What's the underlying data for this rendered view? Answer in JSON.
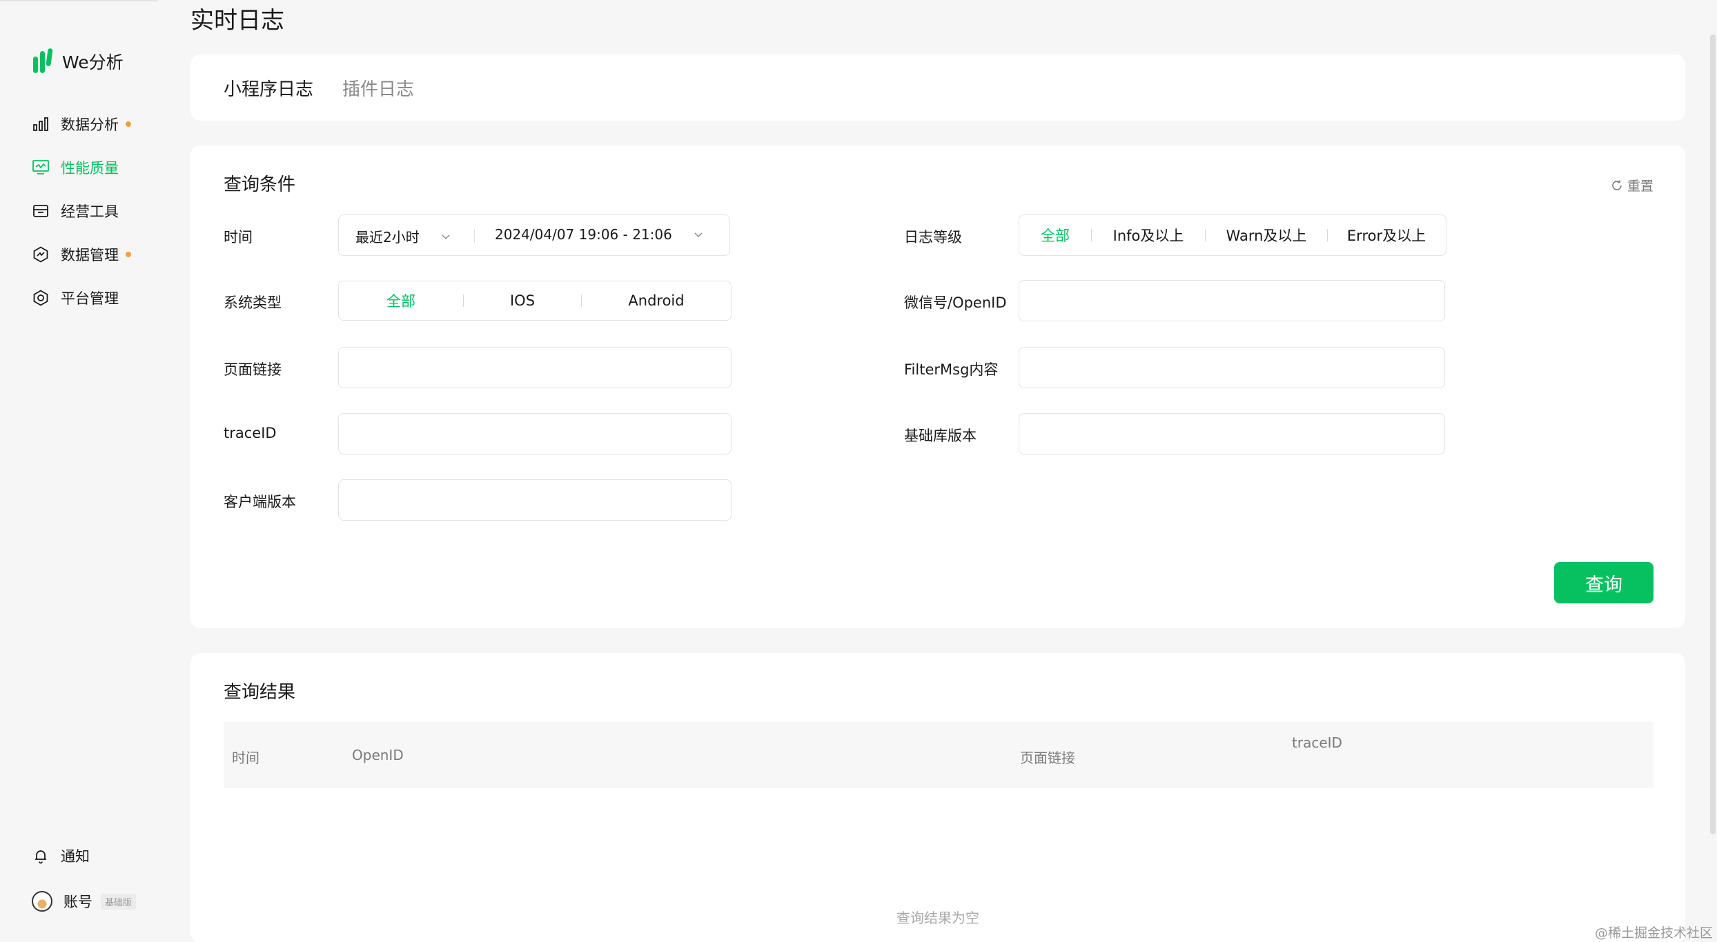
{
  "page": {
    "title": "实时日志"
  },
  "sidebar": {
    "brand": "We分析",
    "items": [
      {
        "label": "数据分析",
        "icon": "bar-chart-icon",
        "dot": true,
        "active": false
      },
      {
        "label": "性能质量",
        "icon": "monitor-icon",
        "dot": false,
        "active": true
      },
      {
        "label": "经营工具",
        "icon": "shop-icon",
        "dot": false,
        "active": false
      },
      {
        "label": "数据管理",
        "icon": "data-hexagon-icon",
        "dot": true,
        "active": false
      },
      {
        "label": "平台管理",
        "icon": "settings-hexagon-icon",
        "dot": false,
        "active": false
      }
    ],
    "bottom": {
      "notify_label": "通知",
      "account_label": "账号",
      "account_badge": "基础版"
    }
  },
  "tabs": [
    {
      "label": "小程序日志",
      "active": true
    },
    {
      "label": "插件日志",
      "active": false
    }
  ],
  "query": {
    "title": "查询条件",
    "reset_label": "重置",
    "time": {
      "label": "时间",
      "range": "最近2小时",
      "date": "2024/04/07 19:06 - 21:06"
    },
    "level": {
      "label": "日志等级",
      "options": [
        "全部",
        "Info及以上",
        "Warn及以上",
        "Error及以上"
      ],
      "selected": 0
    },
    "system": {
      "label": "系统类型",
      "options": [
        "全部",
        "IOS",
        "Android"
      ],
      "selected": 0
    },
    "fields": {
      "wechat": {
        "label": "微信号/OpenID",
        "value": "",
        "placeholder": ""
      },
      "page_link": {
        "label": "页面链接",
        "value": "",
        "placeholder": ""
      },
      "filter_msg": {
        "label": "FilterMsg内容",
        "value": "",
        "placeholder": ""
      },
      "trace_id": {
        "label": "traceID",
        "value": "",
        "placeholder": ""
      },
      "lib_version": {
        "label": "基础库版本",
        "value": "",
        "placeholder": ""
      },
      "client_version": {
        "label": "客户端版本",
        "value": "",
        "placeholder": ""
      }
    },
    "submit_label": "查询"
  },
  "results": {
    "title": "查询结果",
    "columns": [
      "时间",
      "OpenID",
      "页面链接",
      "traceID"
    ],
    "empty_text": "查询结果为空"
  },
  "watermark": "@稀土掘金技术社区",
  "colors": {
    "accent": "#07c160",
    "dot": "#fa9d3b",
    "background": "#f6f6f6"
  }
}
